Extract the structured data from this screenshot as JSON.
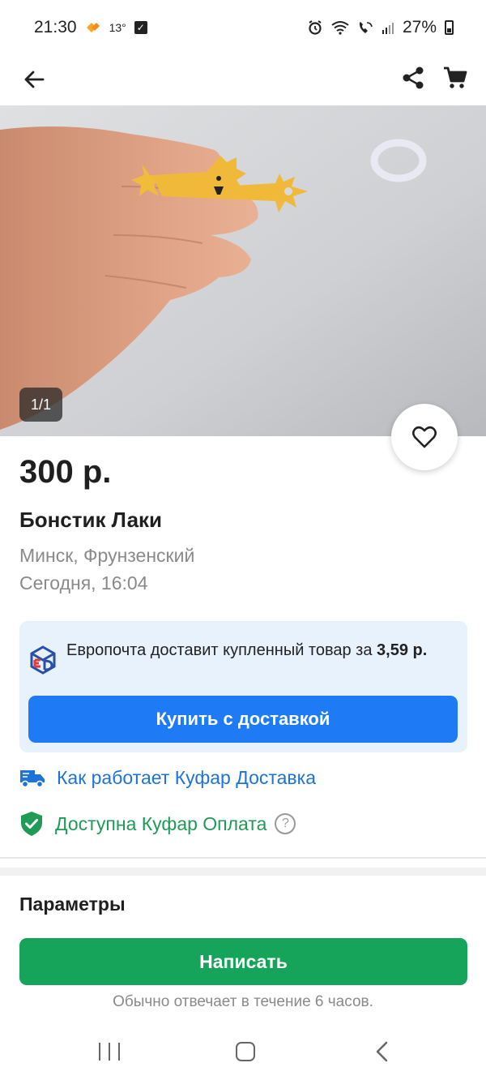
{
  "status_bar": {
    "time": "21:30",
    "temperature": "13°",
    "battery": "27%"
  },
  "app_bar": {
    "back_icon": "arrow-left-icon",
    "share_icon": "share-icon",
    "cart_icon": "cart-icon"
  },
  "gallery": {
    "counter": "1/1"
  },
  "listing": {
    "price": "300 р.",
    "title": "Бонстик Лаки",
    "location": "Минск, Фрунзенский",
    "date": "Сегодня, 16:04"
  },
  "delivery": {
    "text_prefix": "Европочта доставит купленный товар за ",
    "cost": "3,59 р.",
    "button_label": "Купить с доставкой"
  },
  "links": {
    "how_delivery": "Как работает Куфар Доставка",
    "payment": "Доступна Куфар Оплата",
    "help_glyph": "?"
  },
  "parameters_heading": "Параметры",
  "contact": {
    "write_label": "Написать",
    "reply_note": "Обычно отвечает в течение 6 часов."
  },
  "colors": {
    "primary_blue": "#1e7bf5",
    "link_blue": "#1e73d8",
    "green": "#16a35a",
    "card_bg": "#e8f2fd"
  }
}
